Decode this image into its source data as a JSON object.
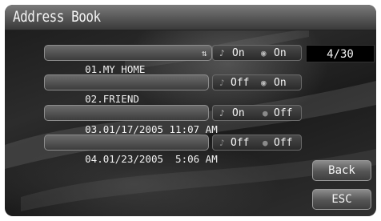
{
  "header": {
    "title": "Address Book"
  },
  "page_indicator": "4/30",
  "entries": [
    {
      "label": "01.MY HOME",
      "icon": "sort-icon",
      "toggle1": "On",
      "toggle2": "On"
    },
    {
      "label": "02.FRIEND",
      "toggle1": "Off",
      "toggle2": "On"
    },
    {
      "label": "03.01/17/2005 11:07 AM",
      "toggle1": "On",
      "toggle2": "Off"
    },
    {
      "label": "04.01/23/2005  5:06 AM",
      "toggle1": "Off",
      "toggle2": "Off"
    }
  ],
  "buttons": {
    "back": "Back",
    "esc": "ESC"
  }
}
